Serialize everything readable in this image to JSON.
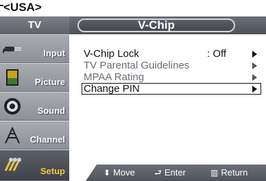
{
  "region_label": "<USA>",
  "sidebar": {
    "header": "TV",
    "items": [
      {
        "label": "Input",
        "icon": "plug-icon"
      },
      {
        "label": "Picture",
        "icon": "picture-icon"
      },
      {
        "label": "Sound",
        "icon": "speaker-icon"
      },
      {
        "label": "Channel",
        "icon": "antenna-icon"
      },
      {
        "label": "Setup",
        "icon": "setup-icon",
        "active": true
      }
    ]
  },
  "menu": {
    "title": "V-Chip",
    "rows": [
      {
        "label": "V-Chip Lock",
        "value": ": Off",
        "state": "enabled"
      },
      {
        "label": "TV Parental Guidelines",
        "value": "",
        "state": "disabled"
      },
      {
        "label": "MPAA Rating",
        "value": "",
        "state": "disabled"
      },
      {
        "label": "Change PIN",
        "value": "",
        "state": "selected"
      }
    ]
  },
  "footer": {
    "move": "Move",
    "enter": "Enter",
    "return": "Return"
  }
}
